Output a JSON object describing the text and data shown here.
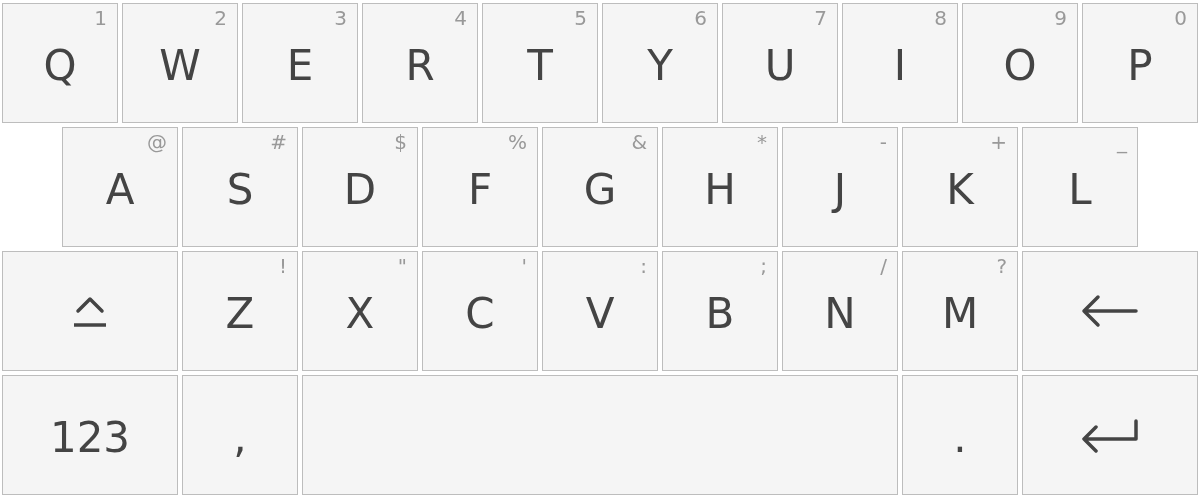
{
  "rows": [
    {
      "keys": [
        {
          "kind": "char",
          "label": "Q",
          "hint": "1"
        },
        {
          "kind": "char",
          "label": "W",
          "hint": "2"
        },
        {
          "kind": "char",
          "label": "E",
          "hint": "3"
        },
        {
          "kind": "char",
          "label": "R",
          "hint": "4"
        },
        {
          "kind": "char",
          "label": "T",
          "hint": "5"
        },
        {
          "kind": "char",
          "label": "Y",
          "hint": "6"
        },
        {
          "kind": "char",
          "label": "U",
          "hint": "7"
        },
        {
          "kind": "char",
          "label": "I",
          "hint": "8"
        },
        {
          "kind": "char",
          "label": "O",
          "hint": "9"
        },
        {
          "kind": "char",
          "label": "P",
          "hint": "0"
        }
      ]
    },
    {
      "keys": [
        {
          "kind": "char",
          "label": "A",
          "hint": "@"
        },
        {
          "kind": "char",
          "label": "S",
          "hint": "#"
        },
        {
          "kind": "char",
          "label": "D",
          "hint": "$"
        },
        {
          "kind": "char",
          "label": "F",
          "hint": "%"
        },
        {
          "kind": "char",
          "label": "G",
          "hint": "&"
        },
        {
          "kind": "char",
          "label": "H",
          "hint": "*"
        },
        {
          "kind": "char",
          "label": "J",
          "hint": "-"
        },
        {
          "kind": "char",
          "label": "K",
          "hint": "+"
        },
        {
          "kind": "char",
          "label": "L",
          "hint": "_"
        }
      ]
    },
    {
      "keys": [
        {
          "kind": "shift"
        },
        {
          "kind": "char",
          "label": "Z",
          "hint": "!"
        },
        {
          "kind": "char",
          "label": "X",
          "hint": "\""
        },
        {
          "kind": "char",
          "label": "C",
          "hint": "'"
        },
        {
          "kind": "char",
          "label": "V",
          "hint": ":"
        },
        {
          "kind": "char",
          "label": "B",
          "hint": ";"
        },
        {
          "kind": "char",
          "label": "N",
          "hint": "/"
        },
        {
          "kind": "char",
          "label": "M",
          "hint": "?"
        },
        {
          "kind": "backspace"
        }
      ]
    },
    {
      "keys": [
        {
          "kind": "mode",
          "label": "123"
        },
        {
          "kind": "char",
          "label": ","
        },
        {
          "kind": "space"
        },
        {
          "kind": "char",
          "label": "."
        },
        {
          "kind": "enter"
        }
      ]
    }
  ]
}
